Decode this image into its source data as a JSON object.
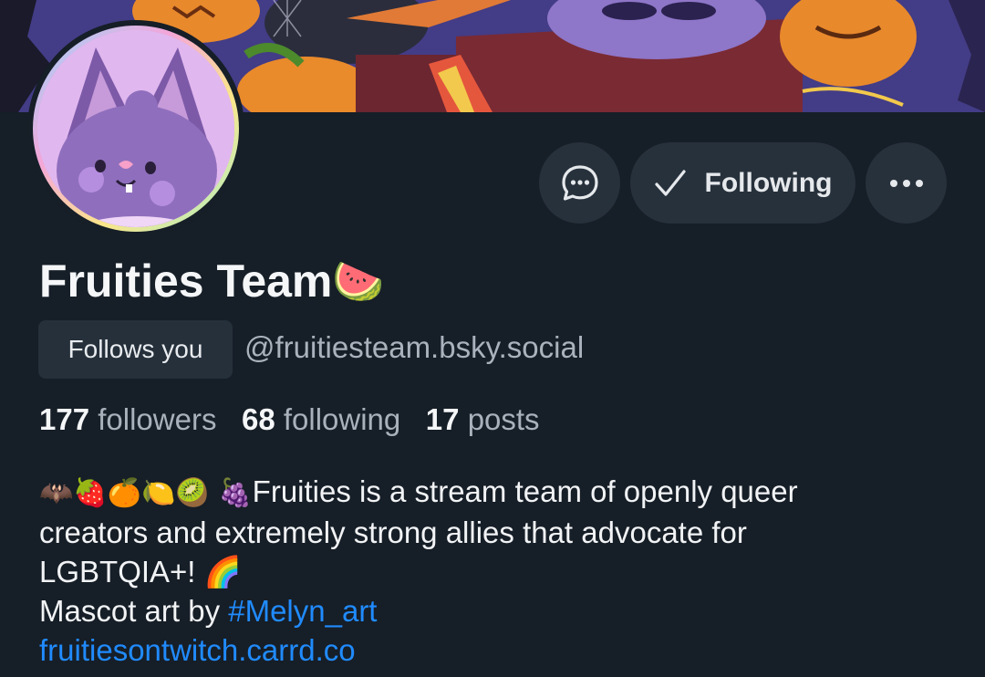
{
  "profile": {
    "display_name": "Fruities Team",
    "name_emoji": "🍉",
    "follows_you_label": "Follows you",
    "handle": "@fruitiesteam.bsky.social"
  },
  "actions": {
    "following_label": "Following",
    "message_icon": "chat-bubble-icon",
    "more_icon": "ellipsis-icon"
  },
  "stats": {
    "followers_count": "177",
    "followers_label": "followers",
    "following_count": "68",
    "following_label": "following",
    "posts_count": "17",
    "posts_label": "posts"
  },
  "bio": {
    "emojis": "🦇🍓🍊🍋🥝 🍇",
    "line1_text": "Fruities is a stream team of openly queer",
    "line2": "creators and extremely strong allies that advocate for",
    "line3_text": "LGBTQIA+! ",
    "line3_emoji": "🌈",
    "line4_prefix": "Mascot art by ",
    "line4_link": "#Melyn_art",
    "line5_link": "fruitiesontwitch.carrd.co"
  },
  "colors": {
    "background": "#161e27",
    "button_bg": "#27313c",
    "link": "#208bfe",
    "muted_text": "#a9b2bc"
  }
}
